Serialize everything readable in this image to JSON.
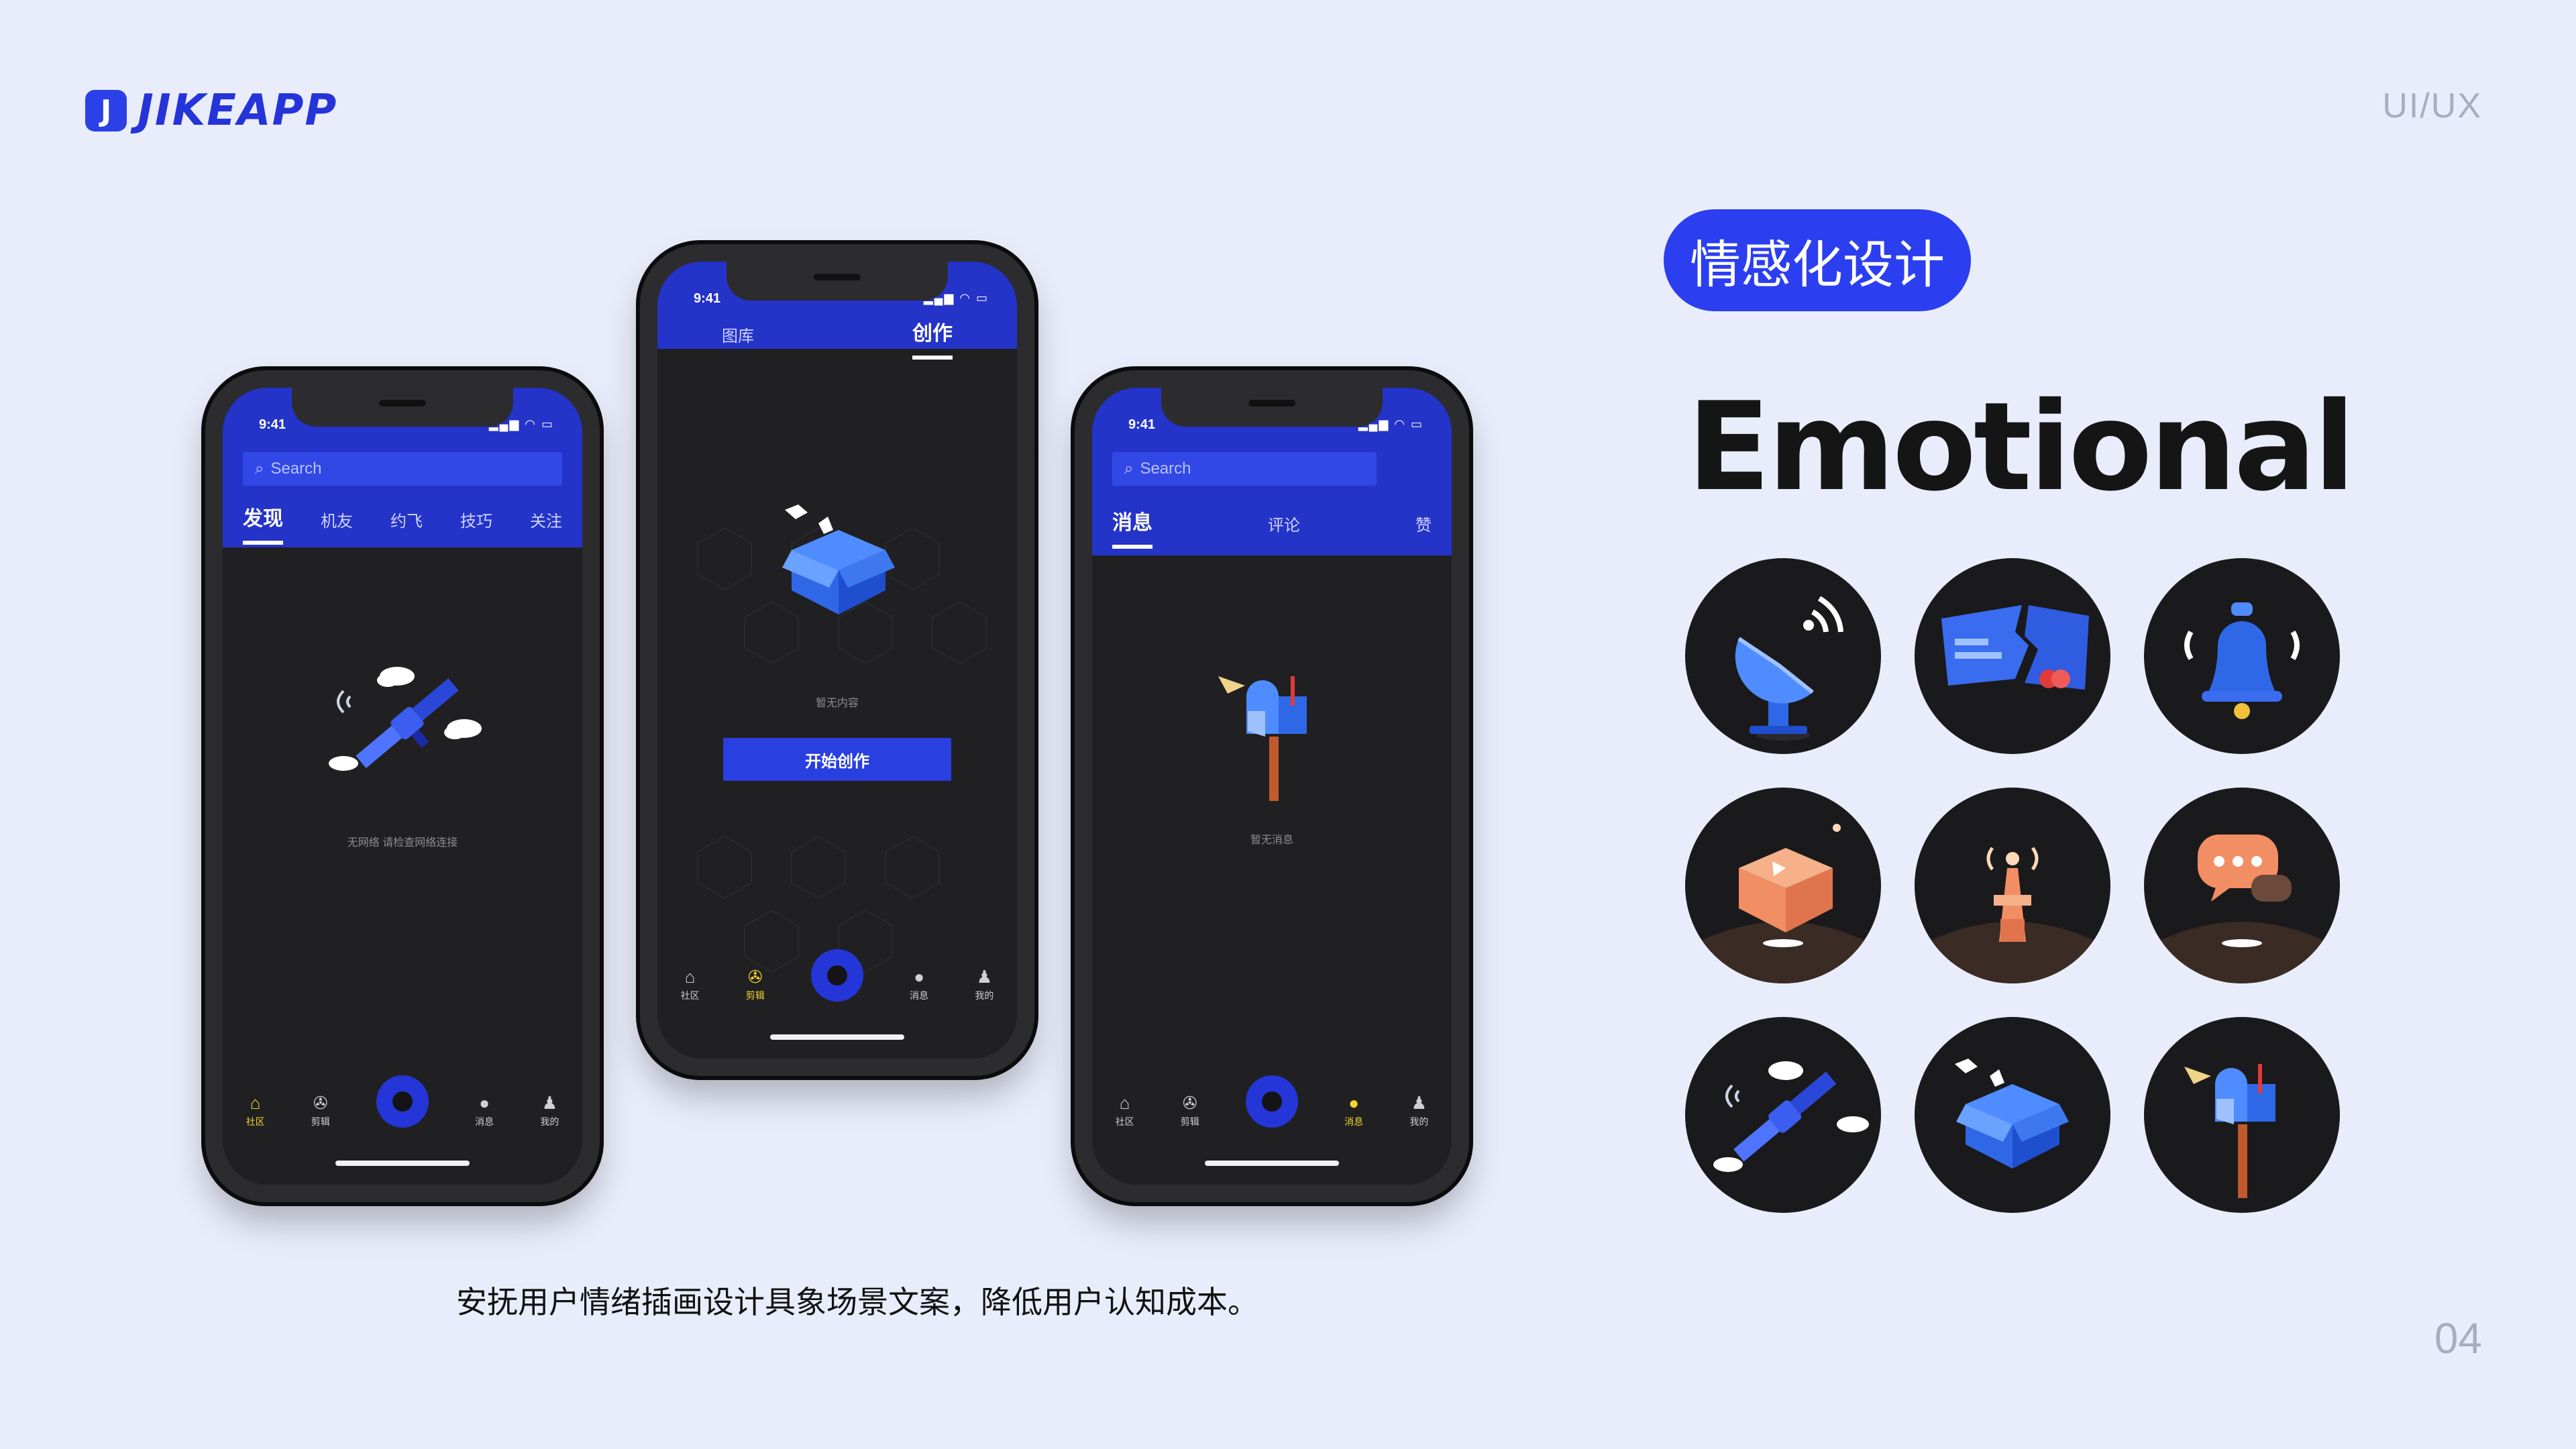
{
  "brand": {
    "mark": "J",
    "name": "JIKEAPP"
  },
  "section_tag": "UI/UX",
  "page_number": "04",
  "caption": "安抚用户情绪插画设计具象场景文案，降低用户认知成本。",
  "pill": "情感化设计",
  "headline": "Emotional",
  "phone_common": {
    "time": "9:41",
    "status": "▂▄▆ ◠ ▭"
  },
  "phone1": {
    "search": "Search",
    "tabs": [
      "发现",
      "机友",
      "约飞",
      "技巧",
      "关注"
    ],
    "empty": "无网络  请检查网络连接",
    "tabbar": [
      "社区",
      "剪辑",
      "",
      "消息",
      "我的"
    ]
  },
  "phone2": {
    "tabs": [
      "图库",
      "创作"
    ],
    "empty": "暂无内容",
    "cta": "开始创作",
    "tabbar": [
      "社区",
      "剪辑",
      "",
      "消息",
      "我的"
    ]
  },
  "phone3": {
    "search": "Search",
    "tabs": [
      "消息",
      "评论",
      "赞"
    ],
    "empty": "暂无消息",
    "tabbar": [
      "社区",
      "剪辑",
      "",
      "消息",
      "我的"
    ]
  },
  "icons": [
    "satellite-dish-icon",
    "broken-card-icon",
    "bell-icon",
    "open-box-scene-icon",
    "signal-tower-icon",
    "chat-bubble-scene-icon",
    "satellite-icon",
    "open-box-icon",
    "mailbox-icon"
  ],
  "colors": {
    "background": "#e9edfb",
    "accent": "#2b3ff0",
    "phone_screen": "#202022",
    "headline": "#151515"
  }
}
